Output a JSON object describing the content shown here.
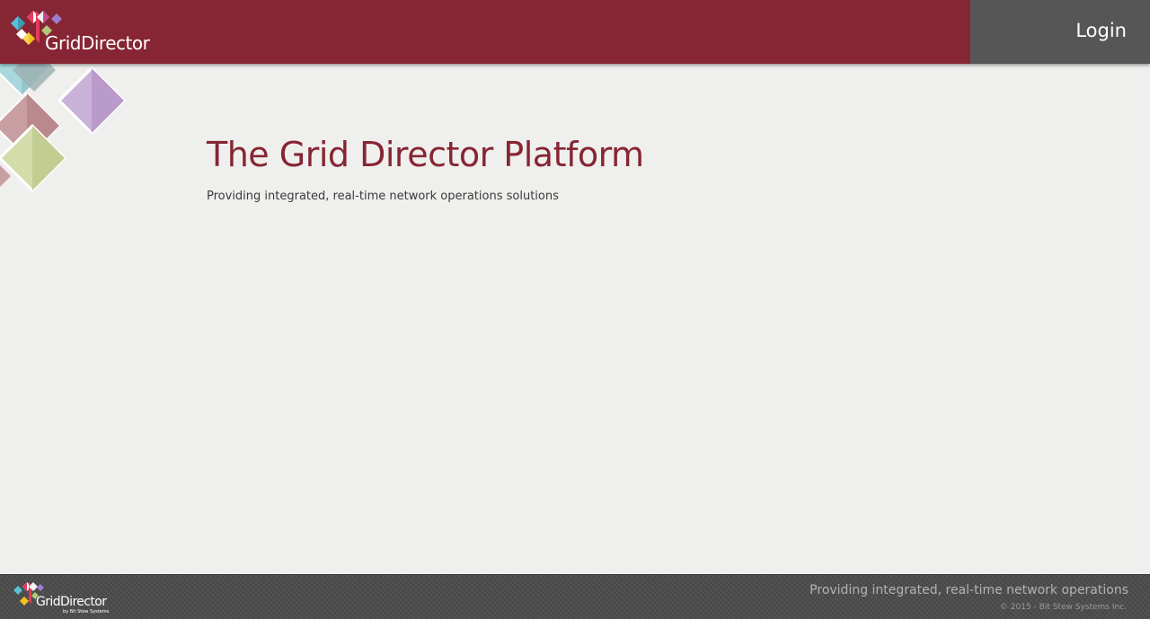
{
  "brand": {
    "name": "GridDirector",
    "byline": "by Bit Stew Systems"
  },
  "header": {
    "login_label": "Login"
  },
  "main": {
    "title": "The Grid Director Platform",
    "subtitle": "Providing integrated, real-time network operations solutions"
  },
  "footer": {
    "tagline": "Providing integrated, real-time network operations",
    "copyright": "© 2015 - Bit Stew Systems Inc."
  },
  "colors": {
    "header_bg": "#862533",
    "login_panel_bg": "#565656",
    "page_bg": "#efefed",
    "title_color": "#862533",
    "footer_bg": "#4e4e4e"
  },
  "icons": {
    "logo": "griddirector-diamonds-logo",
    "decor": "decorative-diamond-pattern"
  }
}
